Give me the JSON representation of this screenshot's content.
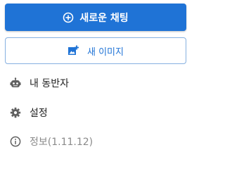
{
  "menu": {
    "new_chat_label": "새로운 채팅",
    "new_image_label": "새 이미지",
    "companion_label": "내 동반자",
    "settings_label": "설정",
    "info_label": "정보(1.11.12)"
  },
  "icons": {
    "new_chat": "add-circle-icon",
    "new_image": "add-photo-icon",
    "companion": "robot-icon",
    "settings": "gear-icon",
    "info": "info-circle-icon"
  },
  "colors": {
    "primary": "#1f73d6",
    "outline_border": "#86b0e0",
    "text": "#222222",
    "muted_text": "#8a8a8a",
    "icon_gray": "#606060"
  }
}
